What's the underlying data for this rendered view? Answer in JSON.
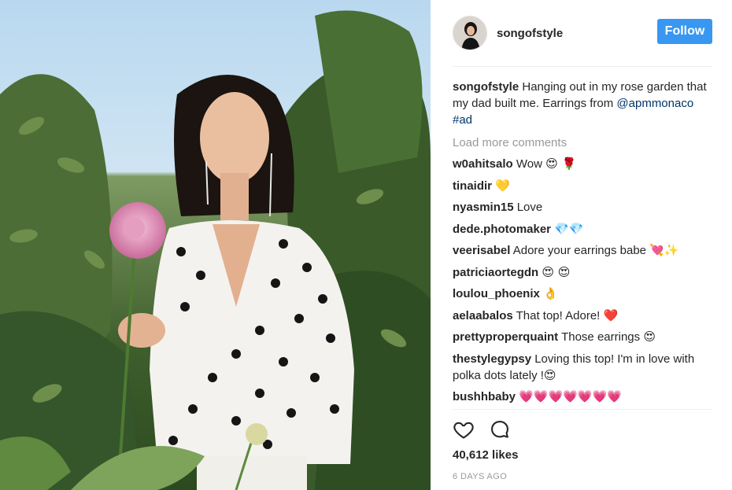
{
  "post": {
    "author": "songofstyle",
    "follow_label": "Follow",
    "caption_user": "songofstyle",
    "caption_text": " Hanging out in my rose garden that my dad built me. Earrings from ",
    "caption_mention": "@apmmonaco",
    "caption_hashtag": "#ad",
    "load_more": "Load more comments",
    "likes": "40,612 likes",
    "time": "6 DAYS AGO"
  },
  "comments": [
    {
      "user": "w0ahitsalo",
      "text": " Wow ",
      "emoji": "😍 🌹"
    },
    {
      "user": "tinaidir",
      "text": " ",
      "emoji": "💛"
    },
    {
      "user": "nyasmin15",
      "text": " Love",
      "emoji": ""
    },
    {
      "user": "dede.photomaker",
      "text": " ",
      "emoji": "💎💎"
    },
    {
      "user": "veerisabel",
      "text": " Adore your earrings babe ",
      "emoji": "💘✨"
    },
    {
      "user": "patriciaortegdn",
      "text": " ",
      "emoji": "😍 😍"
    },
    {
      "user": "loulou_phoenix",
      "text": " ",
      "emoji": "👌"
    },
    {
      "user": "aelaabalos",
      "text": " That top! Adore! ",
      "emoji": "❤️"
    },
    {
      "user": "prettyproperquaint",
      "text": " Those earrings ",
      "emoji": "😍"
    },
    {
      "user": "thestylegypsy",
      "text": " Loving this top! I'm in love with polka dots lately !",
      "emoji": "😍"
    },
    {
      "user": "bushhbaby",
      "text": " ",
      "emoji": "💗💗💗💗💗💗💗"
    }
  ],
  "icons": {
    "like": "heart-outline-icon",
    "comment": "speech-bubble-icon"
  },
  "colors": {
    "follow_bg": "#3897f0",
    "link": "#003569",
    "muted": "#999999"
  }
}
